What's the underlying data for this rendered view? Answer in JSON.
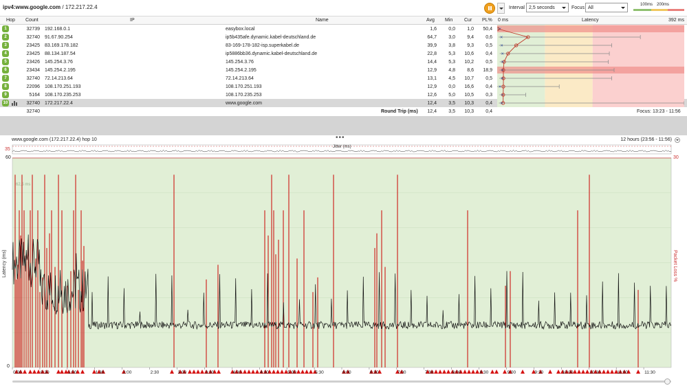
{
  "window": {
    "host": "ipv4:www.google.com",
    "ip": "172.217.22.4"
  },
  "toolbar": {
    "interval_label": "Interval",
    "interval_value": "2,5 seconds",
    "focus_label": "Focus",
    "focus_value": "All",
    "legend_100": "100ms",
    "legend_200": "200ms"
  },
  "table": {
    "columns": {
      "hop": "Hop",
      "count": "Count",
      "ip": "IP",
      "name": "Name",
      "avg": "Avg",
      "min": "Min",
      "cur": "Cur",
      "pl": "PL%",
      "latency": "Latency"
    },
    "latency_scale_min": "0 ms",
    "latency_scale_max": "392 ms",
    "rows": [
      {
        "hop": "1",
        "count": "32739",
        "ip": "192.168.0.1",
        "name": "easybox.local",
        "avg": "1,6",
        "min": "0,0",
        "cur": "1,0",
        "pl": "50,4",
        "avg_ms": 1.6,
        "min_ms": 0.0,
        "max_ms": 2,
        "loss": 50.4
      },
      {
        "hop": "2",
        "count": "32740",
        "ip": "91.67.90.254",
        "name": "ip5b435afe.dynamic.kabel-deutschland.de",
        "avg": "64,7",
        "min": "3,0",
        "cur": "9,4",
        "pl": "0,6",
        "avg_ms": 64.7,
        "min_ms": 3.0,
        "max_ms": 300,
        "loss": 0.6
      },
      {
        "hop": "3",
        "count": "23425",
        "ip": "83.169.178.182",
        "name": "83-169-178-182-isp.superkabel.de",
        "avg": "39,9",
        "min": "3,8",
        "cur": "9,3",
        "pl": "0,5",
        "avg_ms": 39.9,
        "min_ms": 3.8,
        "max_ms": 240,
        "loss": 0.5
      },
      {
        "hop": "4",
        "count": "23425",
        "ip": "88.134.187.54",
        "name": "ip5886bb36.dynamic.kabel-deutschland.de",
        "avg": "22,8",
        "min": "5,3",
        "cur": "10,6",
        "pl": "0,4",
        "avg_ms": 22.8,
        "min_ms": 5.3,
        "max_ms": 235,
        "loss": 0.4
      },
      {
        "hop": "5",
        "count": "23426",
        "ip": "145.254.3.76",
        "name": "145.254.3.76",
        "avg": "14,4",
        "min": "5,3",
        "cur": "10,2",
        "pl": "0,5",
        "avg_ms": 14.4,
        "min_ms": 5.3,
        "max_ms": 233,
        "loss": 0.5
      },
      {
        "hop": "6",
        "count": "23434",
        "ip": "145.254.2.195",
        "name": "145.254.2.195",
        "avg": "12,9",
        "min": "4,8",
        "cur": "8,6",
        "pl": "18,9",
        "avg_ms": 12.9,
        "min_ms": 4.8,
        "max_ms": 245,
        "loss": 18.9
      },
      {
        "hop": "7",
        "count": "32740",
        "ip": "72.14.213.64",
        "name": "72.14.213.64",
        "avg": "13,1",
        "min": "4,5",
        "cur": "10,7",
        "pl": "0,5",
        "avg_ms": 13.1,
        "min_ms": 4.5,
        "max_ms": 240,
        "loss": 0.5
      },
      {
        "hop": "8",
        "count": "22096",
        "ip": "108.170.251.193",
        "name": "108.170.251.193",
        "avg": "12,9",
        "min": "0,0",
        "cur": "16,6",
        "pl": "0,4",
        "avg_ms": 12.9,
        "min_ms": 0.0,
        "max_ms": 130,
        "loss": 0.4
      },
      {
        "hop": "9",
        "count": "5164",
        "ip": "108.170.235.253",
        "name": "108.170.235.253",
        "avg": "12,6",
        "min": "5,0",
        "cur": "10,5",
        "pl": "0,3",
        "avg_ms": 12.6,
        "min_ms": 5.0,
        "max_ms": 60,
        "loss": 0.3
      },
      {
        "hop": "10",
        "count": "32740",
        "ip": "172.217.22.4",
        "name": "www.google.com",
        "avg": "12,4",
        "min": "3,5",
        "cur": "10,3",
        "pl": "0,4",
        "avg_ms": 12.4,
        "min_ms": 3.5,
        "max_ms": 392,
        "loss": 0.4
      }
    ],
    "footer": {
      "count": "32740",
      "label": "Round Trip (ms)",
      "avg": "12,4",
      "min": "3,5",
      "cur": "10,3",
      "pl": "0,4",
      "focus": "Focus: 13:23 - 11:56"
    }
  },
  "graph": {
    "title": "www.google.com (172.217.22.4) hop 10",
    "range": "12 hours (23:56 - 11:56)",
    "jitter_label": "Jitter (ms)",
    "jitter_max": "35",
    "ms_label": "62,5 ms",
    "left_axis_label": "Latency (ms)",
    "right_axis_label": "Packet Loss %",
    "left_max": "60",
    "left_zero": "0",
    "right_max": "30",
    "x_ticks": [
      "0:00",
      "0:30",
      "1:00",
      "1:30",
      "2:00",
      "2:30",
      "3:00",
      "3:30",
      "4:00",
      "4:30",
      "5:00",
      "5:30",
      "6:00",
      "6:30",
      "7:00",
      "7:30",
      "8:00",
      "8:30",
      "9:00",
      "9:30",
      "10:00",
      "10:30",
      "11:00",
      "11:30"
    ],
    "colors": {
      "good": "#e1efd6",
      "warn": "#fbeac6",
      "bad": "#fbd0cf",
      "loss": "#cc0000",
      "latency": "#111111"
    }
  }
}
